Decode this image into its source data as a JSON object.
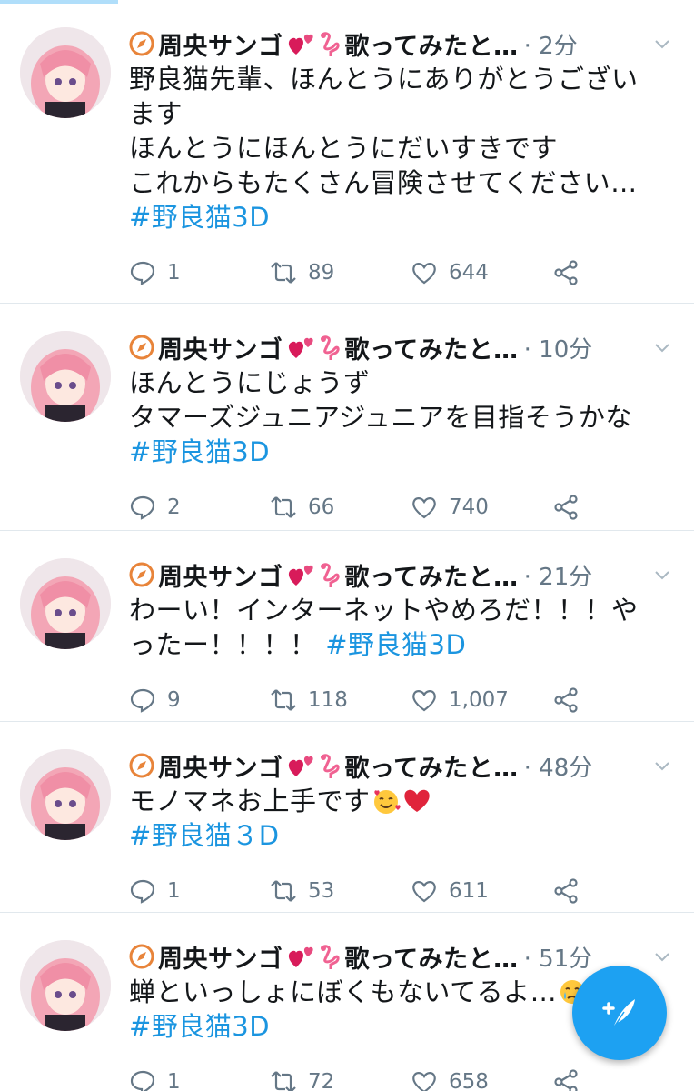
{
  "accent": "#1da1f2",
  "hashtag_color": "#1b95e0",
  "tweets": [
    {
      "name": "周央サンゴ",
      "name_tail": "歌ってみたと…",
      "time": "· 2分",
      "text": "野良猫先輩、ほんとうにありがとうございます\nほんとうにほんとうにだいすきです\nこれからもたくさん冒険させてください…",
      "hashtag": "#野良猫3D",
      "replies": "1",
      "retweets": "89",
      "likes": "644"
    },
    {
      "name": "周央サンゴ",
      "name_tail": "歌ってみたと…",
      "time": "· 10分",
      "text": "ほんとうにじょうず\nタマーズジュニアジュニアを目指そうかな ",
      "hashtag": "#野良猫3D",
      "replies": "2",
      "retweets": "66",
      "likes": "740"
    },
    {
      "name": "周央サンゴ",
      "name_tail": "歌ってみたと…",
      "time": "· 21分",
      "text": "わーい！インターネットやめろだ！！！やったー！！！！ ",
      "hashtag": "#野良猫3D",
      "replies": "9",
      "retweets": "118",
      "likes": "1,007"
    },
    {
      "name": "周央サンゴ",
      "name_tail": "歌ってみたと…",
      "time": "· 48分",
      "text": "モノマネお上手です",
      "hashtag": "#野良猫３D",
      "replies": "1",
      "retweets": "53",
      "likes": "611"
    },
    {
      "name": "周央サンゴ",
      "name_tail": "歌ってみたと…",
      "time": "· 51分",
      "text": "蝉といっしょにぼくもないてるよ…",
      "hashtag": "#野良猫3D",
      "replies": "1",
      "retweets": "72",
      "likes": "658"
    }
  ],
  "icons": {
    "name_badge": "compass-icon",
    "name_emojis": [
      "two-hearts-icon",
      "flamingo-icon"
    ],
    "reply": "reply-icon",
    "retweet": "retweet-icon",
    "like": "heart-icon",
    "share": "share-icon",
    "more": "chevron-down-icon",
    "compose": "compose-tweet-icon"
  }
}
